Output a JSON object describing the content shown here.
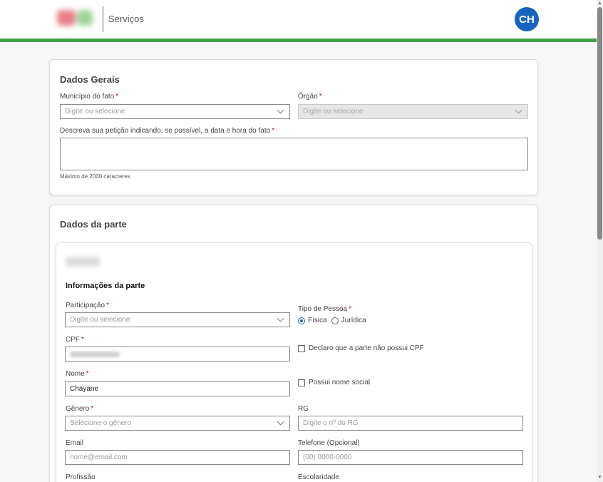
{
  "header": {
    "app_title": "Serviços",
    "avatar_initials": "CH",
    "avatar_color": "#1565c0",
    "accent_bar_color": "#3fa540"
  },
  "dados_gerais": {
    "title": "Dados Gerais",
    "municipio_label": "Município do fato",
    "municipio_placeholder": "Digite ou selecione",
    "orgao_label": "Órgão",
    "orgao_placeholder": "Digite ou selecione",
    "descricao_label": "Descreva sua petição indicando, se possível, a data e hora do fato",
    "descricao_hint": "Máximo de 2000 caracteres"
  },
  "dados_parte": {
    "title": "Dados da parte",
    "informacoes_title": "Informações da parte",
    "participacao_label": "Participação",
    "participacao_placeholder": "Digite ou selecione",
    "tipo_pessoa_label": "Tipo de Pessoa",
    "tipo_fisica": "Física",
    "tipo_juridica": "Jurídica",
    "cpf_label": "CPF",
    "cpf_no_label": "Declaro que a parte não possui CPF",
    "nome_label": "Nome",
    "nome_value": "Chayane",
    "nome_social_label": "Possui nome social",
    "genero_label": "Gênero",
    "genero_placeholder": "Selecione o gênero",
    "rg_label": "RG",
    "rg_placeholder": "Digite o nº do RG",
    "email_label": "Email",
    "email_placeholder": "nome@email.com",
    "telefone_label": "Telefone (Opcional)",
    "telefone_placeholder": "(00) 0000-0000",
    "profissao_label": "Profissão",
    "escolaridade_label": "Escolaridade"
  }
}
